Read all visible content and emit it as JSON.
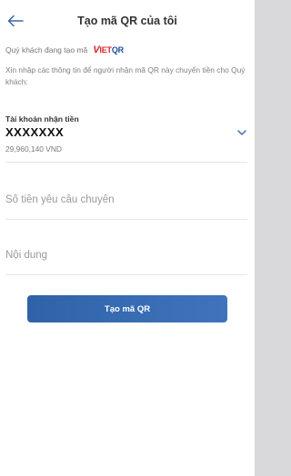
{
  "header": {
    "title": "Tạo mã QR của tôi"
  },
  "creating": {
    "text": "Quý khách đang tạo mã",
    "logo": {
      "v": "V",
      "iet": "IET",
      "qr": "QR"
    }
  },
  "instruction": "Xin nhập các thông tin để người nhận mã QR này chuyển tiền cho Quý khách:",
  "account": {
    "label": "Tài khoản nhận tiền",
    "number": "XXXXXXX",
    "balance": "29,960,140 VND"
  },
  "amount": {
    "placeholder": "Số tiền yêu cầu chuyển",
    "value": ""
  },
  "content": {
    "placeholder": "Nội dung",
    "value": ""
  },
  "submit": {
    "label": "Tạo mã QR"
  },
  "colors": {
    "accent": "#2f62a9",
    "vietqr_red": "#d7262d",
    "vietqr_blue": "#1b4f9c"
  },
  "icons": {
    "back": "arrow-left-icon",
    "dropdown": "chevron-down-icon"
  }
}
